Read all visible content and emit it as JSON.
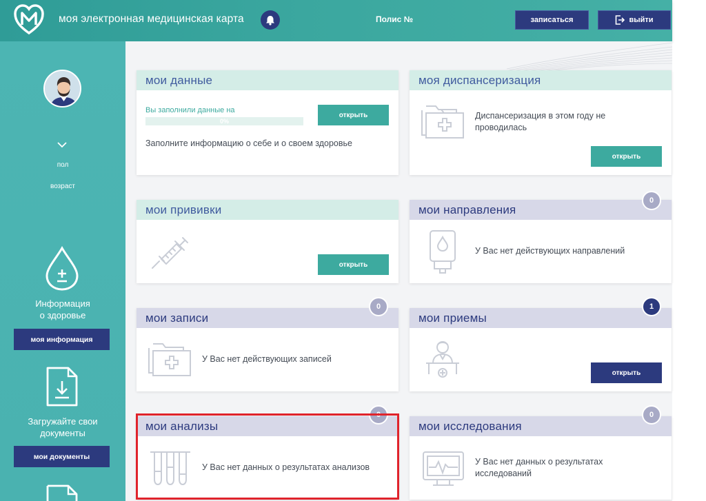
{
  "header": {
    "app_title": "моя электронная медицинская карта",
    "polis_label": "Полис №",
    "signup_button": "записаться",
    "logout_button": "выйти"
  },
  "sidebar": {
    "gender_label": "пол",
    "age_label": "возраст",
    "info_caption_line1": "Информация",
    "info_caption_line2": "о здоровье",
    "info_button": "моя информация",
    "docs_caption_line1": "Загружайте свои",
    "docs_caption_line2": "документы",
    "docs_button": "мои документы"
  },
  "cards": {
    "my_data": {
      "title": "мои данные",
      "progress_label": "Вы заполнили данные на",
      "progress_percent": 0,
      "progress_text": "0%",
      "text": "Заполните информацию о себе и о своем здоровье",
      "button": "открыть"
    },
    "dispensary": {
      "title": "моя диспансеризация",
      "text_line1": "Диспансеризация в этом году не",
      "text_line2": "проводилась",
      "button": "открыть"
    },
    "vaccinations": {
      "title": "мои прививки",
      "button": "открыть"
    },
    "referrals": {
      "title": "мои направления",
      "badge": "0",
      "text": "У Вас нет действующих направлений"
    },
    "appointments": {
      "title": "мои записи",
      "badge": "0",
      "text": "У Вас нет действующих записей"
    },
    "visits": {
      "title": "мои приемы",
      "badge": "1",
      "button": "открыть"
    },
    "analyses": {
      "title": "мои анализы",
      "badge": "0",
      "text": "У Вас нет данных о результатах анализов"
    },
    "research": {
      "title": "мои исследования",
      "badge": "0",
      "text_line1": "У Вас нет данных о результатах",
      "text_line2": "исследований"
    }
  },
  "colors": {
    "teal": "#3daa9f",
    "navy": "#2c3a7e",
    "mint_header": "#d4ede7",
    "lavender_header": "#d7d8e8",
    "highlight": "#e0232b"
  },
  "icons": {
    "logo": "heart-m-logo",
    "bell": "bell-icon",
    "logout": "logout-icon",
    "drop": "drop-plus-minus-icon",
    "download": "document-download-icon"
  }
}
